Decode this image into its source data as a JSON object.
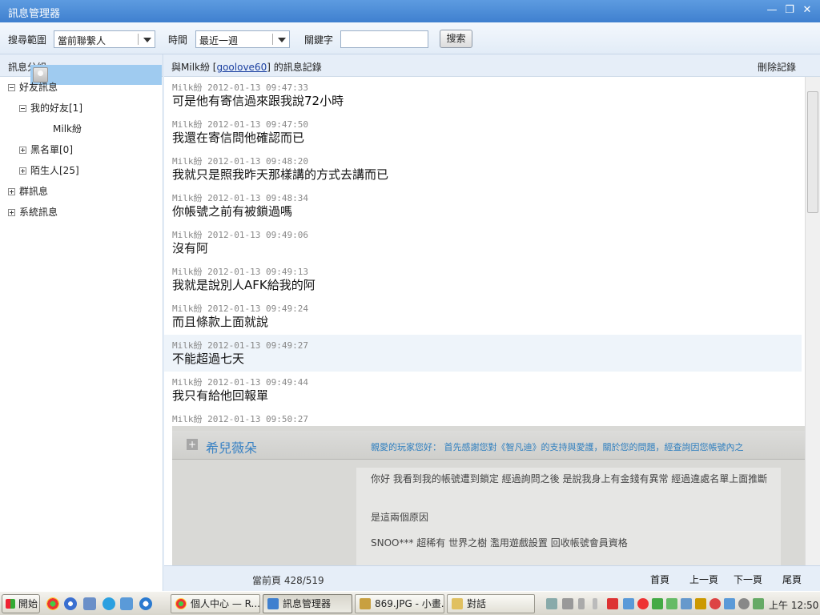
{
  "window": {
    "title": "訊息管理器",
    "minimize": "—",
    "restore": "❐",
    "close": "✕"
  },
  "toolbar": {
    "scope_label": "搜尋範圍",
    "scope_value": "當前聯繫人",
    "time_label": "時間",
    "time_value": "最近一週",
    "keyword_label": "關鍵字",
    "keyword_value": "",
    "search_button": "搜索"
  },
  "sidebar": {
    "header": "訊息分組",
    "items": [
      {
        "label": "好友訊息",
        "expander": "minus"
      },
      {
        "label": "我的好友[1]",
        "expander": "minus"
      },
      {
        "label": "Milk紛",
        "selected": true
      },
      {
        "label": "黑名單[0]",
        "expander": "plus"
      },
      {
        "label": "陌生人[25]",
        "expander": "plus"
      },
      {
        "label": "群訊息",
        "expander": "plus"
      },
      {
        "label": "系統訊息",
        "expander": "plus"
      }
    ]
  },
  "main_header": {
    "prefix": "與Milk紛 [",
    "account": "goolove60",
    "suffix": "] 的訊息記錄",
    "delete_label": "刪除記錄"
  },
  "messages": [
    {
      "meta": "Milk紛 2012-01-13 09:47:33",
      "text": "可是他有寄信過來跟我說72小時"
    },
    {
      "meta": "Milk紛 2012-01-13 09:47:50",
      "text": "我還在寄信問他確認而已"
    },
    {
      "meta": "Milk紛 2012-01-13 09:48:20",
      "text": "我就只是照我昨天那樣講的方式去講而已"
    },
    {
      "meta": "Milk紛 2012-01-13 09:48:34",
      "text": "你帳號之前有被鎖過嗎"
    },
    {
      "meta": "Milk紛 2012-01-13 09:49:06",
      "text": "沒有阿"
    },
    {
      "meta": "Milk紛 2012-01-13 09:49:13",
      "text": "我就是說別人AFK給我的阿"
    },
    {
      "meta": "Milk紛 2012-01-13 09:49:24",
      "text": "而且條款上面就說"
    },
    {
      "meta": "Milk紛 2012-01-13 09:49:27",
      "text": "不能超過七天",
      "highlight": true
    },
    {
      "meta": "Milk紛 2012-01-13 09:49:44",
      "text": "我只有給他回報單"
    },
    {
      "meta": "Milk紛 2012-01-13 09:50:27",
      "text": ""
    }
  ],
  "embedded": {
    "name": "希兒薇朵",
    "greeting": "親愛的玩家您好： 首先感謝您對《智凡迪》的支持與愛護，關於您的問題，經查詢因您帳號內之",
    "paragraphs": [
      "你好 我看到我的帳號遭到鎖定 經過詢問之後 是說我身上有金錢有異常 經過違處名單上面推斷",
      "是這兩個原因",
      "SNOO*** 超稀有 世界之樹 濫用遊戲設置 回收帳號會員資格"
    ]
  },
  "footer": {
    "page_info": "當前頁 428/519",
    "first": "首頁",
    "prev": "上一頁",
    "next": "下一頁",
    "last": "尾頁"
  },
  "taskbar": {
    "start": "開始",
    "tasks": [
      {
        "label": "個人中心 — R...",
        "color": "#4a8a3a",
        "active": false
      },
      {
        "label": "訊息管理器",
        "color": "#3f80cf",
        "active": true
      },
      {
        "label": "869.JPG - 小畫...",
        "color": "#c8a040",
        "active": false
      },
      {
        "label": "對話",
        "color": "#e0c060",
        "active": false
      }
    ],
    "clock": "上午 12:50"
  }
}
